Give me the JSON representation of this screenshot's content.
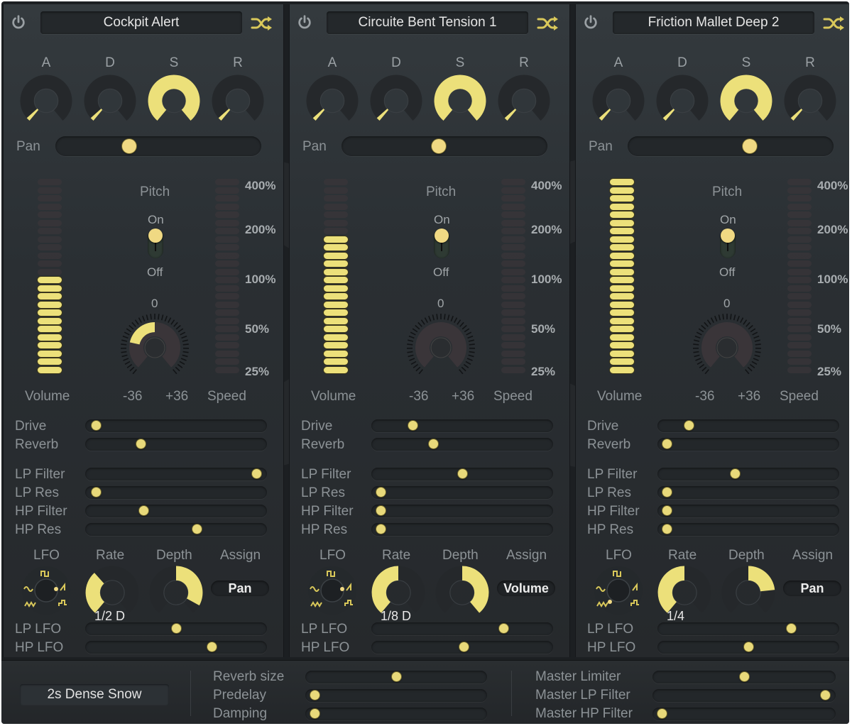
{
  "colors": {
    "accent": "#ece07a",
    "thumb": "#f0d983",
    "panel": "#2a2f33",
    "text": "#8c9296"
  },
  "icons": {
    "power": "power-icon",
    "shuffle": "shuffle-icon",
    "lfo_waves": [
      "square-wave-icon",
      "sine-wave-icon",
      "saw-wave-icon",
      "random-wave-icon",
      "sample-hold-wave-icon"
    ]
  },
  "labels": {
    "attack": "A",
    "decay": "D",
    "sustain": "S",
    "release": "R",
    "pan": "Pan",
    "pitch": "Pitch",
    "on": "On",
    "off": "Off",
    "zero": "0",
    "minus36": "-36",
    "plus36": "+36",
    "volume": "Volume",
    "speed": "Speed",
    "speed_scale": [
      "400%",
      "200%",
      "100%",
      "50%",
      "25%"
    ],
    "drive": "Drive",
    "reverb": "Reverb",
    "lp_filter": "LP  Filter",
    "lp_res": "LP  Res",
    "hp_filter": "HP  Filter",
    "hp_res": "HP  Res",
    "lfo": "LFO",
    "rate": "Rate",
    "depth": "Depth",
    "assign": "Assign",
    "lp_lfo": "LP  LFO",
    "hp_lfo": "HP LFO"
  },
  "panels": [
    {
      "name": "Cockpit Alert",
      "adsr": {
        "attack": 0.03,
        "decay": 0.03,
        "sustain": 1.0,
        "release": 0.03
      },
      "pan": 0.35,
      "volume_segments_lit": 12,
      "volume_segments_total": 24,
      "speed_segments_lit": 0,
      "speed_segments_total": 24,
      "pitch_on": true,
      "pitch": -20,
      "drive": 0.03,
      "reverb": 0.29,
      "lp_filter": 0.97,
      "lp_res": 0.03,
      "hp_filter": 0.31,
      "hp_res": 0.62,
      "lfo_wave": "saw",
      "lfo_rate": 0.35,
      "lfo_rate_label": "1/2 D",
      "lfo_depth": 0.85,
      "assign": "Pan",
      "lp_lfo": 0.5,
      "hp_lfo": 0.71
    },
    {
      "name": "Circuite Bent Tension 1",
      "adsr": {
        "attack": 0.03,
        "decay": 0.03,
        "sustain": 1.0,
        "release": 0.03
      },
      "pan": 0.47,
      "volume_segments_lit": 17,
      "volume_segments_total": 24,
      "speed_segments_lit": 0,
      "speed_segments_total": 24,
      "pitch_on": true,
      "pitch": 0,
      "drive": 0.21,
      "reverb": 0.33,
      "lp_filter": 0.5,
      "lp_res": 0.02,
      "hp_filter": 0.02,
      "hp_res": 0.02,
      "lfo_wave": "saw",
      "lfo_rate": 0.5,
      "lfo_rate_label": "1/8 D",
      "lfo_depth": 1.0,
      "assign": "Volume",
      "lp_lfo": 0.74,
      "hp_lfo": 0.51
    },
    {
      "name": "Friction Mallet Deep 2",
      "adsr": {
        "attack": 0.03,
        "decay": 0.03,
        "sustain": 1.0,
        "release": 0.03
      },
      "pan": 0.6,
      "volume_segments_lit": 24,
      "volume_segments_total": 24,
      "speed_segments_lit": 0,
      "speed_segments_total": 24,
      "pitch_on": true,
      "pitch": 0,
      "drive": 0.15,
      "reverb": 0.02,
      "lp_filter": 0.42,
      "lp_res": 0.02,
      "hp_filter": 0.02,
      "hp_res": 0.02,
      "lfo_wave": "random",
      "lfo_rate": 0.5,
      "lfo_rate_label": "1/4",
      "lfo_depth": 0.6,
      "assign": "Pan",
      "lp_lfo": 0.75,
      "hp_lfo": 0.5
    }
  ],
  "bottom": {
    "preset": "2s Dense Snow",
    "reverb": [
      {
        "label": "Reverb size",
        "value": 0.5
      },
      {
        "label": "Predelay",
        "value": 0.02
      },
      {
        "label": "Damping",
        "value": 0.02
      }
    ],
    "master": [
      {
        "label": "Master Limiter",
        "value": 0.5
      },
      {
        "label": "Master LP Filter",
        "value": 0.97
      },
      {
        "label": "Master HP Filter",
        "value": 0.02
      }
    ]
  }
}
